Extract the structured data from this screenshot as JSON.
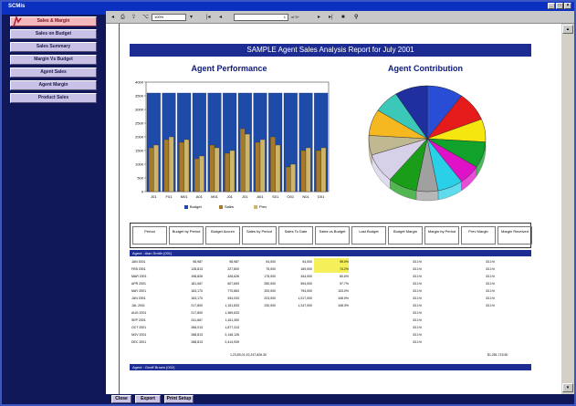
{
  "window": {
    "title": "SCMis"
  },
  "sidebar": {
    "items": [
      {
        "label": "Sales & Margin",
        "active": true
      },
      {
        "label": "Sales on Budget"
      },
      {
        "label": "Sales Summary"
      },
      {
        "label": "Margin Vs Budget"
      },
      {
        "label": "Agent Sales"
      },
      {
        "label": "Agent Margin"
      },
      {
        "label": "Product Sales"
      }
    ]
  },
  "toolbar": {
    "zoom": "100%",
    "page": "1",
    "of_pages": "of 5+"
  },
  "report": {
    "title": "SAMPLE Agent Sales Analysis Report for July 2001",
    "perf_title": "Agent Performance",
    "contrib_title": "Agent Contribution",
    "legend": [
      "Budget",
      "Sales",
      "Prev"
    ]
  },
  "chart_data": [
    {
      "type": "bar",
      "title": "Agent Performance",
      "categories": [
        "J01",
        "F01",
        "M01",
        "A01",
        "M01",
        "J01",
        "J01",
        "A01",
        "S01",
        "O01",
        "N01",
        "D01"
      ],
      "ylim": [
        0,
        4000
      ],
      "yticks": [
        "0",
        "500",
        "1000",
        "1500",
        "2000",
        "2500",
        "3000",
        "3500",
        "4000"
      ],
      "series": [
        {
          "name": "Budget",
          "values": [
            3600,
            3600,
            3600,
            3600,
            3600,
            3600,
            3600,
            3600,
            3600,
            3600,
            3600,
            3600
          ]
        },
        {
          "name": "Sales",
          "values": [
            1600,
            1900,
            1800,
            1200,
            1700,
            1400,
            2300,
            1800,
            2000,
            900,
            1500,
            1500
          ]
        },
        {
          "name": "Prev",
          "values": [
            1700,
            2000,
            1900,
            1300,
            1600,
            1500,
            2100,
            1900,
            1700,
            1000,
            1600,
            1600
          ]
        }
      ],
      "colors": [
        "#1f4ba8",
        "#a57a2a",
        "#cdb56a"
      ]
    },
    {
      "type": "pie",
      "title": "Agent Contribution",
      "values": [
        10,
        9,
        7,
        8,
        6,
        7,
        6,
        8,
        9,
        6,
        8,
        7,
        9
      ],
      "colors": [
        "#2a4dd6",
        "#e51a1a",
        "#f5e60f",
        "#10a22a",
        "#e012c8",
        "#2ad0e8",
        "#a0a0a0",
        "#1a9e1a",
        "#d6d0e8",
        "#c0b890",
        "#f5b820",
        "#3cc8b8",
        "#1f2fa0"
      ],
      "labels": [
        "",
        "",
        "",
        "",
        "",
        "",
        "",
        "",
        "",
        "",
        "",
        "",
        ""
      ]
    }
  ],
  "table": {
    "columns": [
      "Period",
      "Budget by Period",
      "Budget Accum",
      "Sales by Period",
      "Sales To Date",
      "Sales vs Budget",
      "Last Budget",
      "Budget Margin",
      "Margin by Period",
      "Prev Margin",
      "Margin Received"
    ],
    "groups": [
      {
        "agent": "Agent : Alan Smith (001)",
        "rows": [
          [
            "JAN 2001",
            "98,987",
            "98,987",
            "94,000",
            "94,000",
            "95.0%",
            "",
            "33.1%",
            "",
            "33.1%",
            ""
          ],
          [
            "FEB 2001",
            "128,813",
            "227,800",
            "75,000",
            "169,000",
            "74.2%",
            "",
            "33.1%",
            "",
            "33.1%",
            ""
          ],
          [
            "MAR 2001",
            "198,826",
            "426,626",
            "175,000",
            "344,000",
            "80.6%",
            "",
            "33.1%",
            "",
            "33.1%",
            ""
          ],
          [
            "APR 2001",
            "181,067",
            "607,693",
            "250,000",
            "594,000",
            "97.7%",
            "",
            "33.1%",
            "",
            "33.1%",
            ""
          ],
          [
            "MAY 2001",
            "163,170",
            "770,863",
            "200,000",
            "794,000",
            "103.0%",
            "",
            "33.1%",
            "",
            "33.1%",
            ""
          ],
          [
            "JUN 2001",
            "163,170",
            "934,033",
            "223,000",
            "1,017,000",
            "108.9%",
            "",
            "33.1%",
            "",
            "33.1%",
            ""
          ],
          [
            "JUL 2001",
            "217,800",
            "1,151,833",
            "230,000",
            "1,247,000",
            "108.3%",
            "",
            "33.1%",
            "",
            "33.1%",
            ""
          ],
          [
            "AUG 2001",
            "217,800",
            "1,369,633",
            "",
            "",
            "",
            "",
            "33.1%",
            "",
            "",
            ""
          ],
          [
            "SEP 2001",
            "241,667",
            "1,611,300",
            "",
            "",
            "",
            "",
            "33.1%",
            "",
            "",
            ""
          ],
          [
            "OCT 2001",
            "266,013",
            "1,877,313",
            "",
            "",
            "",
            "",
            "33.1%",
            "",
            "",
            ""
          ],
          [
            "NOV 2001",
            "268,813",
            "2,146,126",
            "",
            "",
            "",
            "",
            "33.1%",
            "",
            "",
            ""
          ],
          [
            "DEC 2001",
            "268,813",
            "2,414,939",
            "",
            "",
            "",
            "",
            "33.1%",
            "",
            "",
            ""
          ]
        ]
      },
      {
        "agent": "Agent : Geoff Brown (002)",
        "rows": []
      }
    ],
    "footer": {
      "total": "1,23,83,01,92,247,826.30",
      "total2": "$1,281,715.50"
    }
  },
  "bottom": {
    "buttons": [
      "Close",
      "Export",
      "Print Setup"
    ]
  }
}
